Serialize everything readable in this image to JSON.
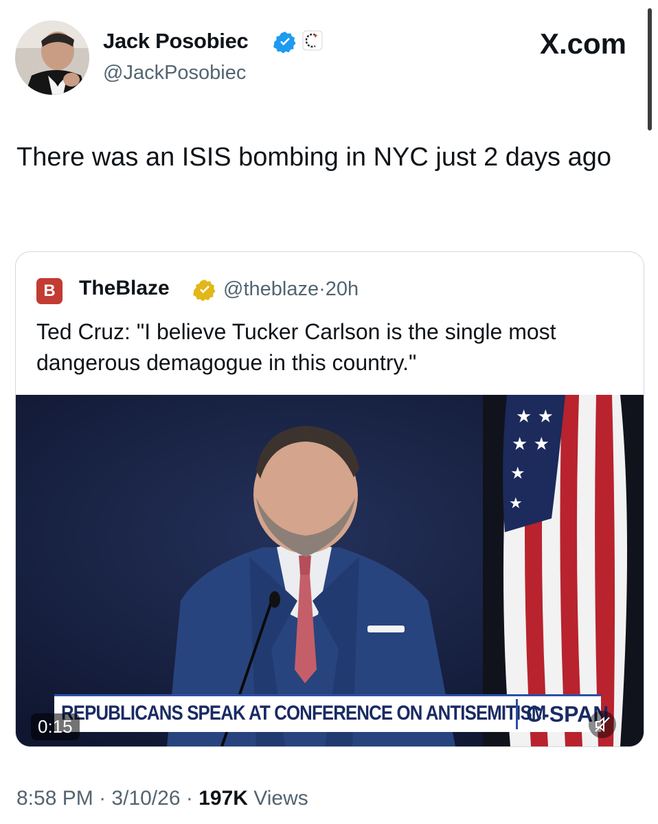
{
  "tweet": {
    "author_name": "Jack Posobiec",
    "author_handle": "@JackPosobiec",
    "site_label": "X.com",
    "text": "There was an ISIS bombing in NYC just 2 days ago",
    "time": "8:58 PM",
    "date": "3/10/26",
    "views_count": "197K",
    "views_label": "Views",
    "separator": "·"
  },
  "quote": {
    "logo_letter": "B",
    "name": "TheBlaze",
    "handle": "@theblaze",
    "age": "20h",
    "text": "Ted Cruz: \"I believe Tucker Carlson is the single most dangerous demagogue in this country.\""
  },
  "video": {
    "timer": "0:15",
    "chyron": "REPUBLICANS SPEAK AT CONFERENCE ON ANTISEMITISM",
    "brand": "C-SPAN"
  },
  "icons": {
    "verified": "verified-badge-icon",
    "affiliate": "affiliation-badge-icon",
    "mute": "muted-speaker-icon"
  },
  "colors": {
    "verified_blue": "#1d9bf0",
    "verified_gold": "#e2b719",
    "blaze_red": "#c33b32",
    "muted_text": "#536471"
  }
}
